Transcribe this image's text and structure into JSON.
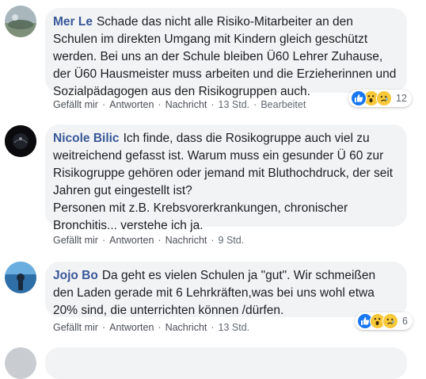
{
  "colors": {
    "author": "#385898",
    "bubble_bg": "#f2f3f5",
    "like_blue": "#1877f2",
    "emoji_yellow": "#f7c83a"
  },
  "comments": [
    {
      "author": "Mer Le",
      "text": "Schade das nicht alle Risiko-Mitarbeiter an den Schulen im direkten Umgang mit Kindern gleich geschützt werden. Bei uns an der Schule bleiben Ü60 Lehrer Zuhause, der Ü60 Hausmeister muss arbeiten und die Erzieherinnen und Sozialpädagogen aus den Risikogruppen auch.",
      "actions": {
        "like": "Gefällt mir",
        "reply": "Antworten",
        "message": "Nachricht",
        "time": "13 Std.",
        "edited": "Bearbeitet"
      },
      "reactions": {
        "icons": [
          "like-icon",
          "wow-icon",
          "sad-icon"
        ],
        "count": "12"
      }
    },
    {
      "author": "Nicole Bilic",
      "text": "Ich finde, dass die Rosikogruppe auch viel zu weitreichend gefasst ist. Warum muss ein gesunder Ü 60 zur Risikogruppe gehören oder jemand mit Bluthochdruck, der seit Jahren gut eingestellt ist?\nPersonen mit z.B. Krebsvorerkrankungen, chronischer Bronchitis... verstehe ich ja.",
      "actions": {
        "like": "Gefällt mir",
        "reply": "Antworten",
        "message": "Nachricht",
        "time": "9 Std."
      }
    },
    {
      "author": "Jojo Bo",
      "text": "Da geht es vielen Schulen ja \"gut\". Wir schmeißen den Laden gerade mit 6 Lehrkräften,was bei uns wohl etwa 20% sind, die unterrichten können /dürfen.",
      "actions": {
        "like": "Gefällt mir",
        "reply": "Antworten",
        "message": "Nachricht",
        "time": "13 Std."
      },
      "reactions": {
        "icons": [
          "like-icon",
          "wow-icon",
          "sad-icon"
        ],
        "count": "6"
      }
    }
  ]
}
